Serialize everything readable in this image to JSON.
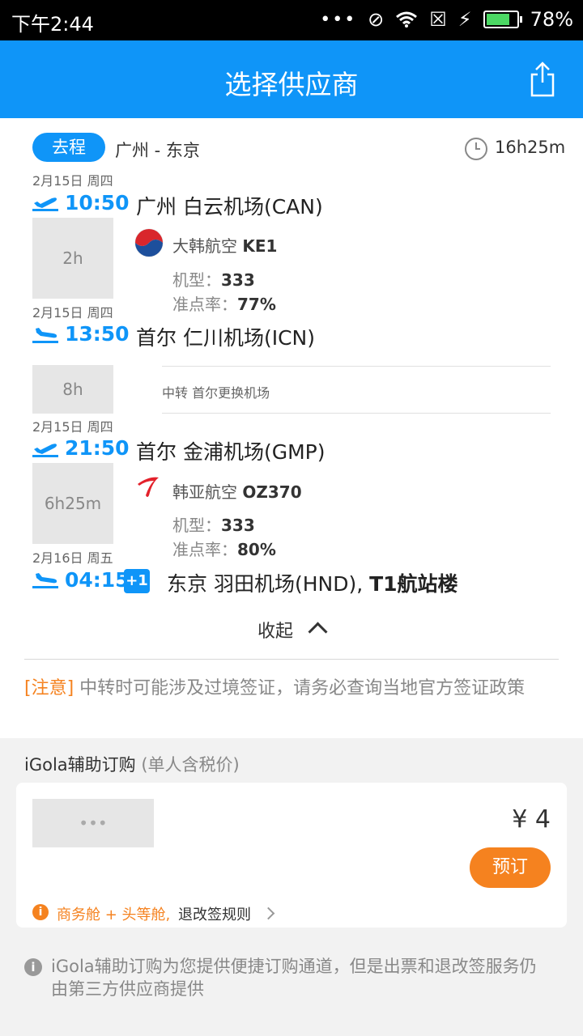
{
  "status": {
    "time": "下午2:44",
    "battery": "78%",
    "battery_level": 0.78
  },
  "header": {
    "title": "选择供应商",
    "share_icon": "share-icon"
  },
  "trip": {
    "direction": "去程",
    "route": "广州 - 东京",
    "total_duration": "16h25m",
    "segments": [
      {
        "date": "2月15日 周四",
        "time": "10:50",
        "airport": "广州 白云机场(CAN)"
      },
      {
        "duration": "2h",
        "airline": "大韩航空",
        "flight": "KE1",
        "model_label": "机型：",
        "model": "333",
        "ontime_label": "准点率：",
        "ontime": "77%"
      },
      {
        "date": "2月15日 周四",
        "time": "13:50",
        "airport": "首尔 仁川机场(ICN)"
      },
      {
        "layover": "8h",
        "transfer_text": "中转  首尔更换机场"
      },
      {
        "date": "2月15日 周四",
        "time": "21:50",
        "airport": "首尔 金浦机场(GMP)"
      },
      {
        "duration": "6h25m",
        "airline": "韩亚航空",
        "flight": "OZ370",
        "model_label": "机型：",
        "model": "333",
        "ontime_label": "准点率：",
        "ontime": "80%"
      },
      {
        "date": "2月16日 周五",
        "time": "04:15",
        "plus_day": "+1",
        "airport": "东京 羽田机场(HND),",
        "terminal": "T1航站楼"
      }
    ],
    "collapse_label": "收起"
  },
  "notice": {
    "tag": "[注意]",
    "text": "中转时可能涉及过境签证，请务必查询当地官方签证政策"
  },
  "supplier_section": {
    "title": "iGola辅助订购",
    "subtitle": "(单人含税价)",
    "logo_placeholder": "•••",
    "price": "¥ 4",
    "book_label": "预订",
    "cabin_text": "商务舱 + 头等舱,",
    "rule_text": "退改签规则"
  },
  "footer_note": "iGola辅助订购为您提供便捷订购通道，但是出票和退改签服务仍由第三方供应商提供",
  "colors": {
    "primary": "#0f95f8",
    "accent": "#f5821f"
  }
}
